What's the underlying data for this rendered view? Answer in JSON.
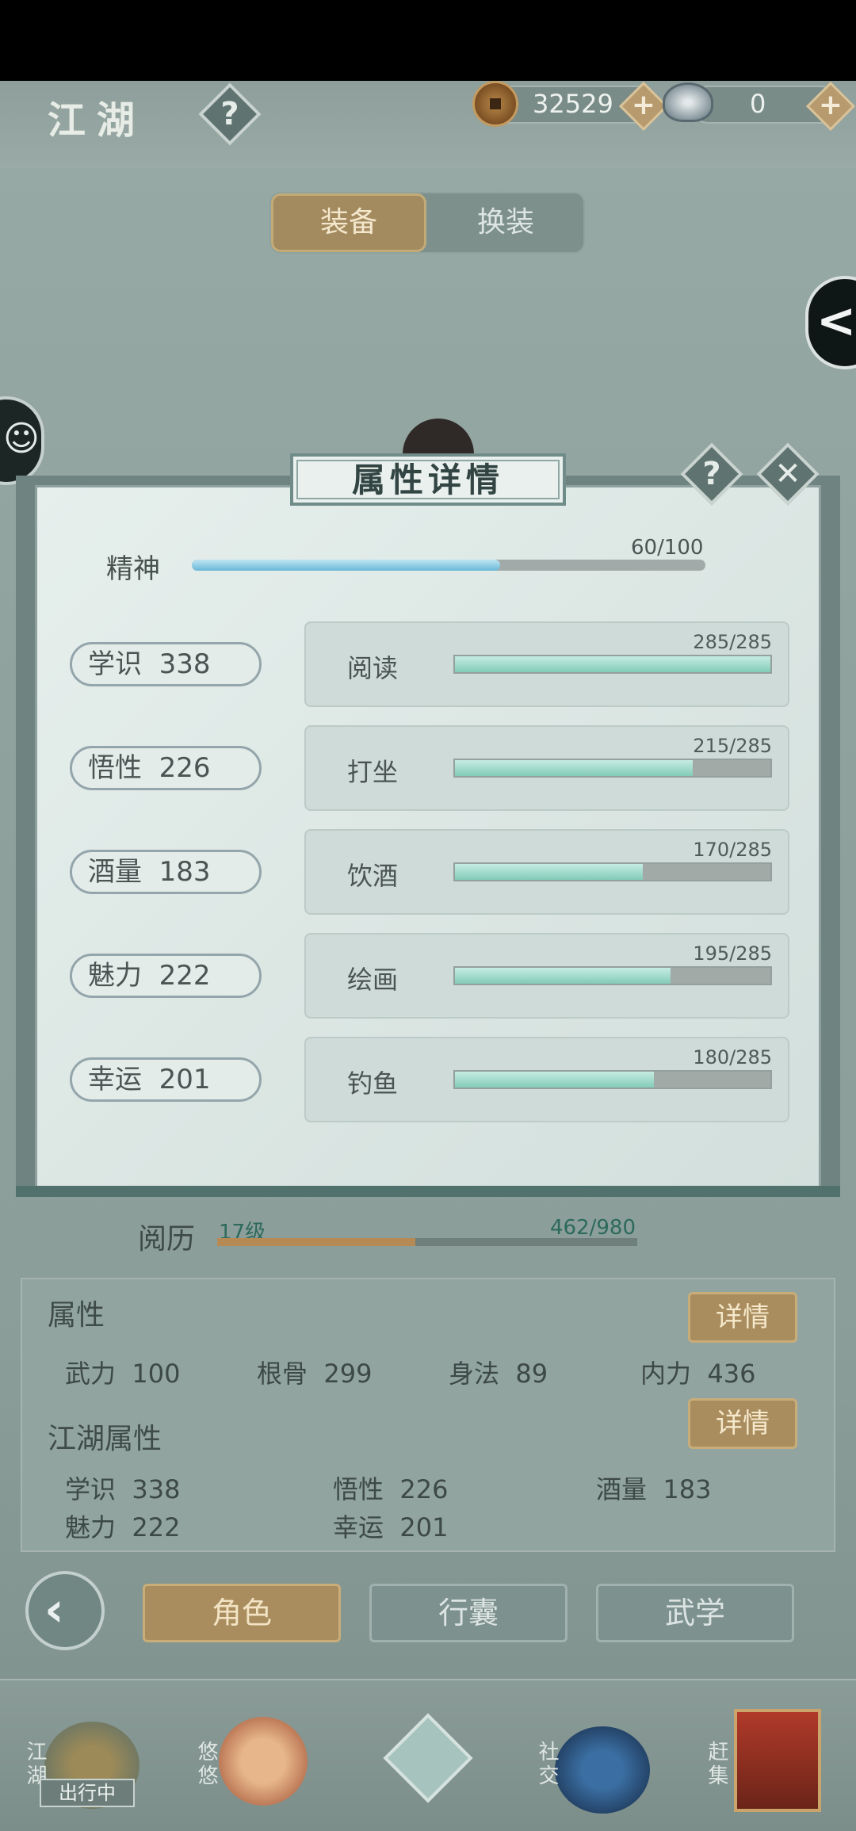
{
  "header": {
    "title": "江湖",
    "help_glyph": "?",
    "coins": "32529",
    "silver": "0",
    "plus_glyph": "+"
  },
  "equip_tabs": {
    "equip": "装备",
    "change": "换装"
  },
  "modal": {
    "title": "属性详情",
    "help_glyph": "?",
    "close_glyph": "✕",
    "spirit": {
      "label": "精神",
      "value": "60/100",
      "current": 60,
      "max": 100
    },
    "rows": [
      {
        "stat": "学识  338",
        "skill": "阅读",
        "value": "285/285",
        "current": 285,
        "max": 285
      },
      {
        "stat": "悟性  226",
        "skill": "打坐",
        "value": "215/285",
        "current": 215,
        "max": 285
      },
      {
        "stat": "酒量  183",
        "skill": "饮酒",
        "value": "170/285",
        "current": 170,
        "max": 285
      },
      {
        "stat": "魅力  222",
        "skill": "绘画",
        "value": "195/285",
        "current": 195,
        "max": 285
      },
      {
        "stat": "幸运  201",
        "skill": "钓鱼",
        "value": "180/285",
        "current": 180,
        "max": 285
      }
    ]
  },
  "experience": {
    "label": "阅历",
    "level": "17级",
    "value": "462/980",
    "current": 462,
    "max": 980
  },
  "attributes": {
    "title": "属性",
    "detail": "详情",
    "items": [
      "武力  100",
      "根骨  299",
      "身法  89",
      "内力  436"
    ]
  },
  "jianghu_attributes": {
    "title": "江湖属性",
    "detail": "详情",
    "items": [
      "学识  338",
      "悟性  226",
      "酒量  183",
      "魅力  222",
      "幸运  201"
    ]
  },
  "bottom_tabs": {
    "back_glyph": "‹",
    "role": "角色",
    "bag": "行囊",
    "martial": "武学"
  },
  "side": {
    "back_glyph": "<",
    "chat_glyph": "☺"
  },
  "nav": {
    "jianghu": "江湖",
    "travel": "出行中",
    "youyou": "悠悠",
    "social": "社交",
    "market": "赶集"
  },
  "colors": {
    "accent_gold": "#a98d5e",
    "skill_fill": "#83cbb8",
    "spirit_fill": "#69b8d8",
    "exp_fill": "#b68a55"
  }
}
